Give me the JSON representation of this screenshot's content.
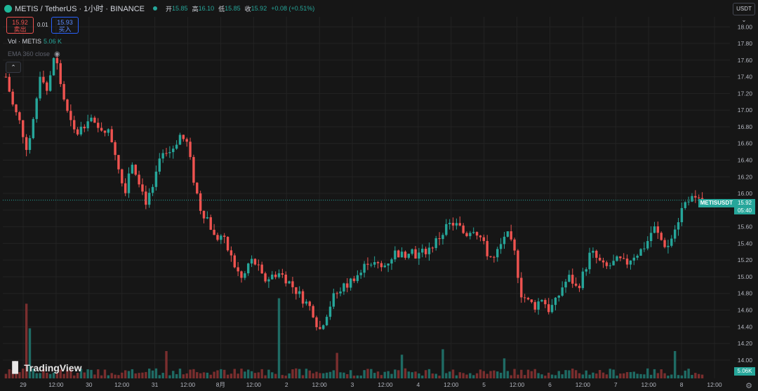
{
  "header": {
    "symbol": "METIS / TetherUS · 1小时 · BINANCE",
    "open_label": "开",
    "open": "15.85",
    "high_label": "高",
    "high": "16.10",
    "low_label": "低",
    "low": "15.85",
    "close_label": "收",
    "close": "15.92",
    "change": "+0.08 (+0.51%)"
  },
  "trade": {
    "sell_price": "15.92",
    "sell_label": "卖出",
    "spread": "0.01",
    "buy_price": "15.93",
    "buy_label": "买入"
  },
  "indicators": {
    "volume_label": "Vol · METIS",
    "volume_value": "5.06 K",
    "ema_label": "EMA 360 close"
  },
  "currency_selector": "USDT ⌄",
  "brand": "TradingView",
  "last_price_tag": {
    "symbol": "METISUSDT",
    "price": "15.92",
    "countdown": "05:40"
  },
  "volume_tag": "5.06K",
  "colors": {
    "up": "#26a69a",
    "down": "#ef5350",
    "grid": "#232323",
    "background": "#161616"
  },
  "chart_data": {
    "type": "candlestick",
    "y_ticks": [
      "18.00",
      "17.80",
      "17.60",
      "17.40",
      "17.20",
      "17.00",
      "16.80",
      "16.60",
      "16.40",
      "16.20",
      "16.00",
      "15.80",
      "15.60",
      "15.40",
      "15.20",
      "15.00",
      "14.80",
      "14.60",
      "14.40",
      "14.20",
      "14.00"
    ],
    "ylim": [
      13.78,
      18.12
    ],
    "x_ticks": [
      "29",
      "12:00",
      "30",
      "12:00",
      "31",
      "12:00",
      "8月",
      "12:00",
      "2",
      "12:00",
      "3",
      "12:00",
      "4",
      "12:00",
      "5",
      "12:00",
      "6",
      "12:00",
      "7",
      "12:00",
      "8",
      "12:00"
    ],
    "last_price": 15.92,
    "close_path": [
      [
        0,
        17.4
      ],
      [
        2,
        17.05
      ],
      [
        4,
        16.85
      ],
      [
        6,
        16.55
      ],
      [
        8,
        16.9
      ],
      [
        10,
        17.5
      ],
      [
        12,
        17.2
      ],
      [
        14,
        17.7
      ],
      [
        16,
        17.25
      ],
      [
        18,
        16.9
      ],
      [
        20,
        16.7
      ],
      [
        22,
        16.8
      ],
      [
        24,
        16.95
      ],
      [
        26,
        16.75
      ],
      [
        28,
        16.8
      ],
      [
        30,
        16.7
      ],
      [
        32,
        16.4
      ],
      [
        34,
        16.0
      ],
      [
        36,
        16.4
      ],
      [
        38,
        16.2
      ],
      [
        40,
        15.9
      ],
      [
        42,
        16.0
      ],
      [
        44,
        16.4
      ],
      [
        46,
        16.45
      ],
      [
        48,
        16.55
      ],
      [
        50,
        16.7
      ],
      [
        52,
        16.6
      ],
      [
        54,
        16.15
      ],
      [
        56,
        15.8
      ],
      [
        58,
        15.7
      ],
      [
        60,
        15.45
      ],
      [
        62,
        15.5
      ],
      [
        64,
        15.3
      ],
      [
        66,
        15.1
      ],
      [
        68,
        14.95
      ],
      [
        70,
        15.2
      ],
      [
        72,
        15.15
      ],
      [
        74,
        14.95
      ],
      [
        76,
        15.0
      ],
      [
        78,
        15.05
      ],
      [
        80,
        15.0
      ],
      [
        82,
        14.9
      ],
      [
        84,
        14.8
      ],
      [
        86,
        14.7
      ],
      [
        88,
        14.6
      ],
      [
        90,
        14.35
      ],
      [
        92,
        14.55
      ],
      [
        94,
        14.75
      ],
      [
        96,
        14.85
      ],
      [
        98,
        14.9
      ],
      [
        100,
        15.0
      ],
      [
        102,
        15.05
      ],
      [
        104,
        15.2
      ],
      [
        106,
        15.15
      ],
      [
        108,
        15.1
      ],
      [
        110,
        15.2
      ],
      [
        112,
        15.3
      ],
      [
        114,
        15.25
      ],
      [
        116,
        15.35
      ],
      [
        118,
        15.25
      ],
      [
        120,
        15.3
      ],
      [
        122,
        15.35
      ],
      [
        124,
        15.45
      ],
      [
        126,
        15.55
      ],
      [
        128,
        15.65
      ],
      [
        130,
        15.6
      ],
      [
        132,
        15.5
      ],
      [
        134,
        15.6
      ],
      [
        136,
        15.5
      ],
      [
        138,
        15.3
      ],
      [
        140,
        15.2
      ],
      [
        142,
        15.35
      ],
      [
        144,
        15.5
      ],
      [
        146,
        15.3
      ],
      [
        148,
        14.8
      ],
      [
        150,
        14.7
      ],
      [
        152,
        14.65
      ],
      [
        154,
        14.75
      ],
      [
        156,
        14.6
      ],
      [
        158,
        14.7
      ],
      [
        160,
        14.9
      ],
      [
        162,
        15.0
      ],
      [
        164,
        14.85
      ],
      [
        166,
        15.05
      ],
      [
        168,
        15.3
      ],
      [
        170,
        15.2
      ],
      [
        172,
        15.1
      ],
      [
        174,
        15.15
      ],
      [
        176,
        15.2
      ],
      [
        178,
        15.15
      ],
      [
        180,
        15.25
      ],
      [
        182,
        15.3
      ],
      [
        184,
        15.4
      ],
      [
        186,
        15.6
      ],
      [
        188,
        15.45
      ],
      [
        190,
        15.35
      ],
      [
        192,
        15.55
      ],
      [
        194,
        15.8
      ],
      [
        196,
        15.95
      ],
      [
        198,
        15.9
      ],
      [
        200,
        15.92
      ]
    ],
    "volume_scale": [
      0,
      1
    ],
    "volume_highlights": [
      [
        6,
        0.82
      ],
      [
        7,
        0.55
      ],
      [
        80,
        0.88
      ],
      [
        116,
        0.26
      ],
      [
        146,
        0.22
      ],
      [
        196,
        0.3
      ],
      [
        47,
        0.3
      ],
      [
        128,
        0.32
      ],
      [
        97,
        0.28
      ]
    ]
  }
}
